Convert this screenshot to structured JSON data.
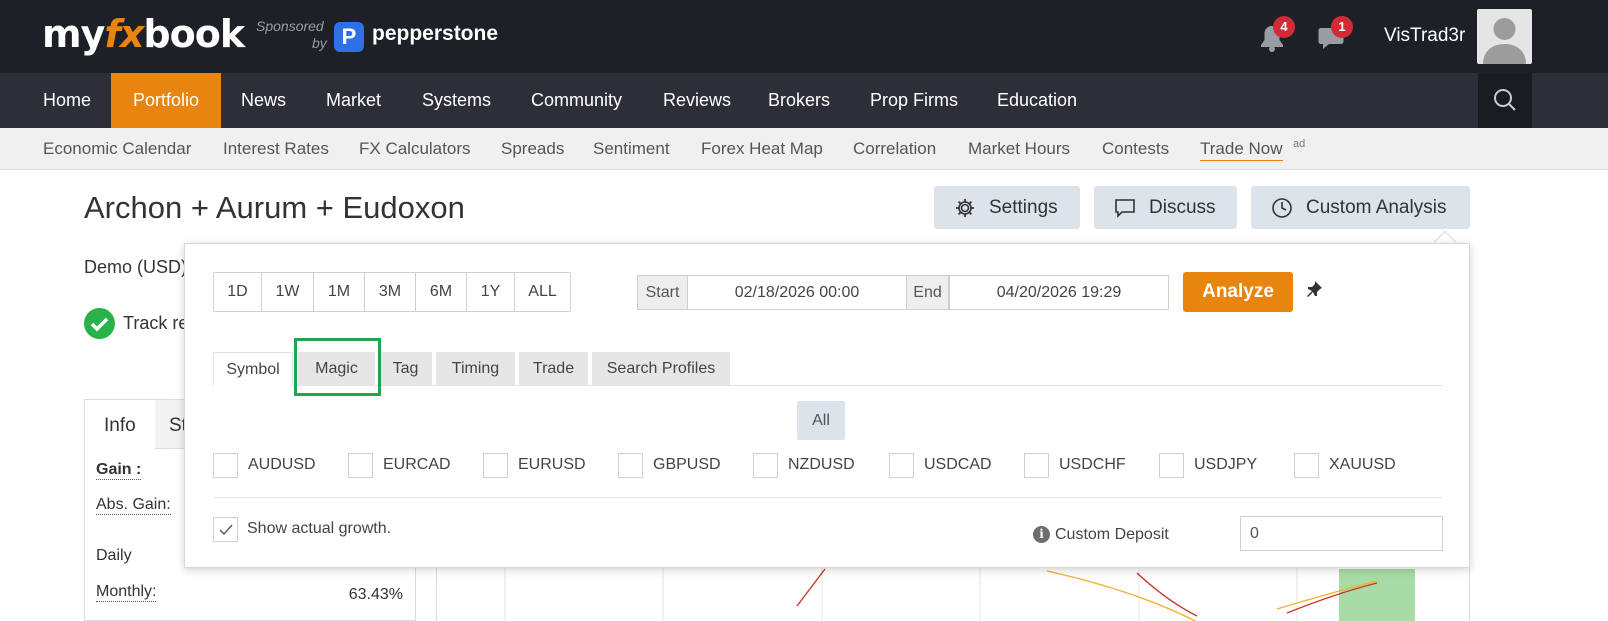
{
  "header": {
    "logo_my": "my",
    "logo_fx": "fx",
    "logo_book": "book",
    "sponsored": "Sponsored",
    "by": "by",
    "sponsor_mark": "P",
    "sponsor_name": "pepperstone",
    "notifications_count": "4",
    "messages_count": "1",
    "username": "VisTrad3r"
  },
  "nav": {
    "items": [
      "Home",
      "Portfolio",
      "News",
      "Market",
      "Systems",
      "Community",
      "Reviews",
      "Brokers",
      "Prop Firms",
      "Education"
    ],
    "active": "Portfolio"
  },
  "subnav": {
    "items": [
      "Economic Calendar",
      "Interest Rates",
      "FX Calculators",
      "Spreads",
      "Sentiment",
      "Forex Heat Map",
      "Correlation",
      "Market Hours",
      "Contests",
      "Trade Now"
    ],
    "ad": "ad"
  },
  "page": {
    "title": "Archon + Aurum + Eudoxon",
    "settings": "Settings",
    "discuss": "Discuss",
    "custom_analysis": "Custom Analysis",
    "account_type": "Demo (USD)",
    "track_record": "Track re"
  },
  "info_panel": {
    "tab_info": "Info",
    "tab_stats": "St",
    "gain_label": "Gain :",
    "abs_gain_label": "Abs. Gain:",
    "daily_label": "Daily",
    "monthly_label": "Monthly:",
    "monthly_value": "63.43%"
  },
  "popover": {
    "ranges": [
      "1D",
      "1W",
      "1M",
      "3M",
      "6M",
      "1Y",
      "ALL"
    ],
    "start_label": "Start",
    "start_value": "02/18/2026 00:00",
    "end_label": "End",
    "end_value": "04/20/2026 19:29",
    "analyze": "Analyze",
    "pin_icon": "pushpin-icon",
    "tabs": [
      "Symbol",
      "Magic",
      "Tag",
      "Timing",
      "Trade",
      "Search Profiles"
    ],
    "active_tab": "Symbol",
    "all": "All",
    "symbols": [
      "AUDUSD",
      "EURCAD",
      "EURUSD",
      "GBPUSD",
      "NZDUSD",
      "USDCAD",
      "USDCHF",
      "USDJPY",
      "XAUUSD"
    ],
    "show_growth": "Show actual growth.",
    "show_growth_checked": true,
    "info_icon": "i",
    "custom_deposit_label": "Custom Deposit",
    "custom_deposit_value": "0"
  },
  "colors": {
    "brand_orange": "#e8850f",
    "topbar": "#1e2027",
    "nav": "#2c2f38",
    "highlight_green": "#1fa84b",
    "badge_red": "#d22a36"
  }
}
